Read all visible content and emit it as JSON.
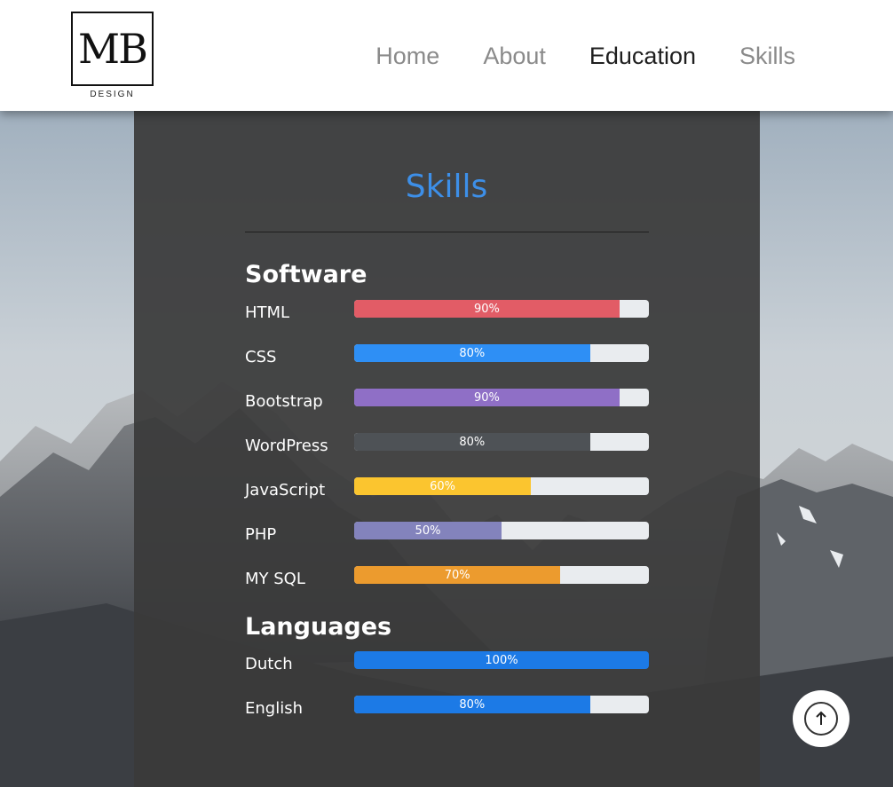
{
  "logo": {
    "letters": "MB",
    "subtitle": "DESIGN"
  },
  "nav": {
    "items": [
      {
        "label": "Home",
        "active": false
      },
      {
        "label": "About",
        "active": false
      },
      {
        "label": "Education",
        "active": true
      },
      {
        "label": "Skills",
        "active": false
      }
    ]
  },
  "skills": {
    "title": "Skills",
    "title_color": "#3d8fe8",
    "software": {
      "heading": "Software",
      "items": [
        {
          "label": "HTML",
          "percent": 90,
          "text": "90%",
          "color": "#e25c66"
        },
        {
          "label": "CSS",
          "percent": 80,
          "text": "80%",
          "color": "#2e8ff5"
        },
        {
          "label": "Bootstrap",
          "percent": 90,
          "text": "90%",
          "color": "#8f6fc6"
        },
        {
          "label": "WordPress",
          "percent": 80,
          "text": "80%",
          "color": "#4e5256"
        },
        {
          "label": "JavaScript",
          "percent": 60,
          "text": "60%",
          "color": "#fbc52f"
        },
        {
          "label": "PHP",
          "percent": 50,
          "text": "50%",
          "color": "#8383bc"
        },
        {
          "label": "MY SQL",
          "percent": 70,
          "text": "70%",
          "color": "#ec9b2e"
        }
      ]
    },
    "languages": {
      "heading": "Languages",
      "items": [
        {
          "label": "Dutch",
          "percent": 100,
          "text": "100%",
          "color": "#1c7ae6"
        },
        {
          "label": "English",
          "percent": 80,
          "text": "80%",
          "color": "#1c7ae6"
        }
      ]
    }
  },
  "scroll_top": {
    "icon": "arrow-up-icon"
  }
}
